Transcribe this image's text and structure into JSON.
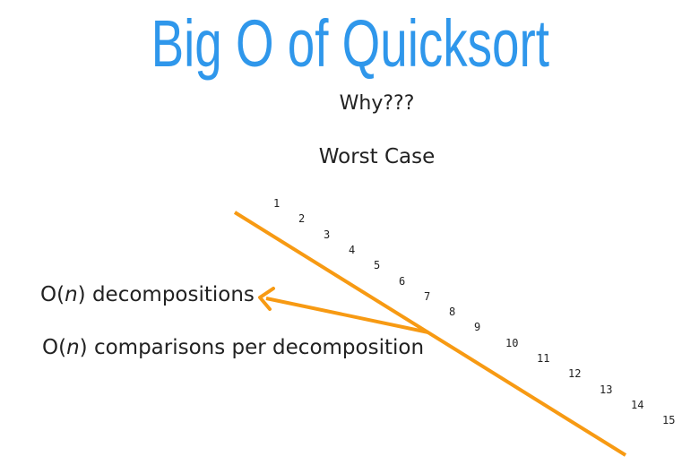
{
  "title": "Big O of Quicksort",
  "subtitle": "Why???",
  "case_label": "Worst Case",
  "annotations": {
    "decomp_prefix": "O(",
    "decomp_var": "n",
    "decomp_suffix": ") decompositions",
    "comp_prefix": "O(",
    "comp_var": "n",
    "comp_suffix": ") comparisons per decomposition"
  },
  "recursion_steps": [
    "1",
    "2",
    "3",
    "4",
    "5",
    "6",
    "7",
    "8",
    "9",
    "10",
    "11",
    "12",
    "13",
    "14",
    "15"
  ],
  "colors": {
    "title": "#2f97eb",
    "accent": "#f79a13",
    "text": "#222222"
  }
}
